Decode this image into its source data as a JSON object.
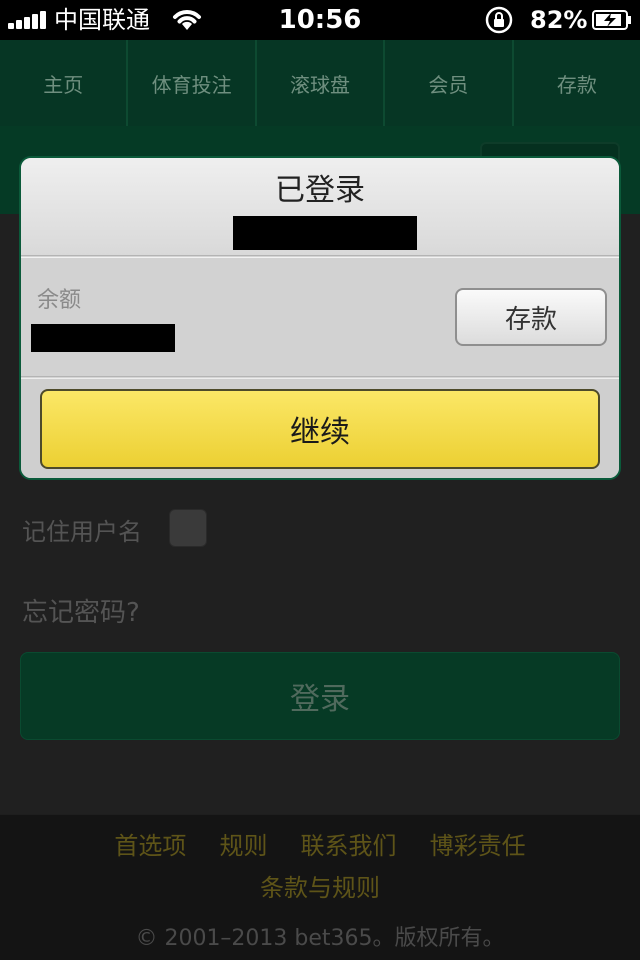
{
  "status_bar": {
    "carrier": "中国联通",
    "time": "10:56",
    "battery_percent": "82%"
  },
  "nav": {
    "items": [
      "主页",
      "体育投注",
      "滚球盘",
      "会员",
      "存款"
    ]
  },
  "login_form": {
    "remember_label": "记住用户名",
    "forgot_password": "忘记密码?",
    "login_button": "登录"
  },
  "footer": {
    "links": [
      "首选项",
      "规则",
      "联系我们",
      "博彩责任"
    ],
    "terms": "条款与规则",
    "copyright": "© 2001–2013 bet365。版权所有。"
  },
  "modal": {
    "title": "已登录",
    "balance_label": "余额",
    "deposit_button": "存款",
    "continue_button": "继续"
  },
  "colors": {
    "nav_bg": "#063624",
    "modal_border": "#0b5a3a",
    "continue_yellow": "#f4db4a",
    "footer_link": "#5e5418"
  }
}
